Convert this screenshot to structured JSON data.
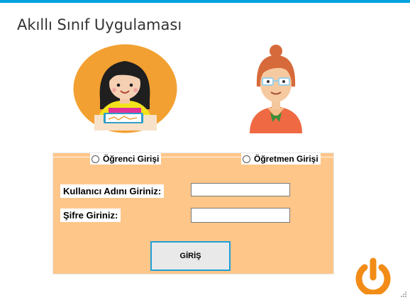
{
  "app": {
    "title": "Akıllı Sınıf Uygulaması",
    "accent": "#00a2e0"
  },
  "login": {
    "role_student": "Öğrenci Girişi",
    "role_teacher": "Öğretmen Girişi",
    "username_label": "Kullanıcı Adını Giriniz:",
    "password_label": "Şifre Giriniz:",
    "username_value": "",
    "password_value": "",
    "submit_label": "GİRİŞ",
    "panel_color": "#ffc68a"
  },
  "icons": {
    "student": "student-avatar-icon",
    "teacher": "teacher-avatar-icon",
    "power": "power-icon",
    "resize": "resize-grip-icon"
  }
}
